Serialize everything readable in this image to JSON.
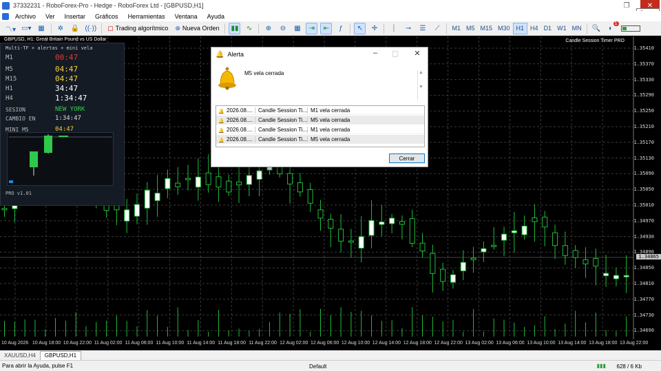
{
  "window": {
    "title": "37332231 - RoboForex-Pro - Hedge - RoboForex Ltd - [GBPUSD,H1]",
    "close_tooltip": "Cerrar"
  },
  "menu": [
    "Archivo",
    "Ver",
    "Insertar",
    "Gráficos",
    "Herramientas",
    "Ventana",
    "Ayuda"
  ],
  "toolbar": {
    "algo_trading": "Trading algorítmico",
    "new_order": "Nueva Orden",
    "timeframes": [
      "M1",
      "M5",
      "M15",
      "M30",
      "H1",
      "H4",
      "D1",
      "W1",
      "MN"
    ],
    "active_timeframe": "H1",
    "notification_count": "1"
  },
  "chart": {
    "header_left": "GBPUSD, H1:  Great Britain Pound vs US Dollar",
    "header_right": "Candle Session Timer PRO",
    "current_price": "1.34865",
    "price_labels": [
      "1.35410",
      "1.35370",
      "1.35330",
      "1.35290",
      "1.35250",
      "1.35210",
      "1.35170",
      "1.35130",
      "1.35090",
      "1.35050",
      "1.35010",
      "1.34970",
      "1.34930",
      "1.34890",
      "1.34850",
      "1.34810",
      "1.34770",
      "1.34730",
      "1.34690"
    ],
    "time_labels": [
      "10 Aug 2026",
      "10 Aug 18:00",
      "10 Aug 22:00",
      "11 Aug 02:00",
      "11 Aug 06:00",
      "11 Aug 10:00",
      "11 Aug 14:00",
      "11 Aug 18:00",
      "11 Aug 22:00",
      "12 Aug 02:00",
      "12 Aug 06:00",
      "12 Aug 10:00",
      "12 Aug 14:00",
      "12 Aug 18:00",
      "12 Aug 22:00",
      "13 Aug 02:00",
      "13 Aug 06:00",
      "13 Aug 10:00",
      "13 Aug 14:00",
      "13 Aug 18:00",
      "13 Aug 22:00"
    ]
  },
  "panel": {
    "subtitle": "Multi-TF + alertas + mini vela",
    "rows": [
      {
        "label": "M1",
        "value": "00:47",
        "color": "#e53935"
      },
      {
        "label": "M5",
        "value": "04:47",
        "color": "#f2d43a"
      },
      {
        "label": "M15",
        "value": "04:47",
        "color": "#f2d43a"
      },
      {
        "label": "H1",
        "value": "34:47",
        "color": "#ffffff"
      },
      {
        "label": "H4",
        "value": "1:34:47",
        "color": "#ffffff"
      }
    ],
    "session_label": "SESION",
    "session_value": "NEW YORK",
    "change_label": "CAMBIO EN",
    "change_value": "1:34:47",
    "mini_label": "MINI M5",
    "mini_value": "04:47",
    "version": "PRO v1.01"
  },
  "alert": {
    "title": "Alerta",
    "message": "M5 vela cerrada",
    "rows": [
      {
        "time": "2026.08....",
        "source": "Candle Session Ti...",
        "msg": "M1 vela cerrada"
      },
      {
        "time": "2026.08....",
        "source": "Candle Session Ti...",
        "msg": "M5 vela cerrada"
      },
      {
        "time": "2026.08....",
        "source": "Candle Session Ti...",
        "msg": "M1 vela cerrada"
      },
      {
        "time": "2026.08....",
        "source": "Candle Session Ti...",
        "msg": "M5 vela cerrada"
      }
    ],
    "close_button": "Cerrar"
  },
  "tabs": [
    "XAUUSD,H4",
    "GBPUSD,H1"
  ],
  "active_tab": "GBPUSD,H1",
  "status": {
    "help": "Para abrir la Ayuda, pulse F1",
    "profile": "Default",
    "net": "628 / 6 Kb"
  }
}
